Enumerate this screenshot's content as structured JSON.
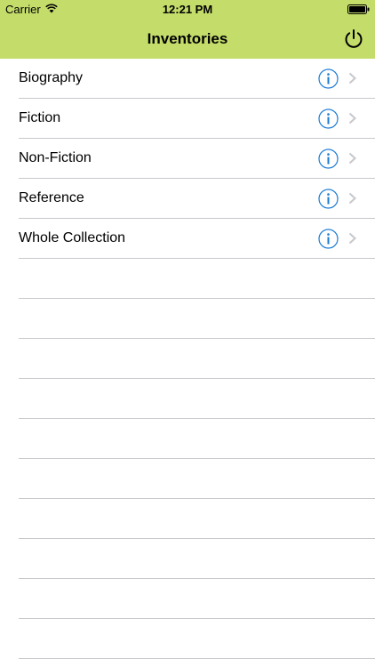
{
  "status_bar": {
    "carrier": "Carrier",
    "time": "12:21 PM",
    "wifi_icon": "wifi-icon",
    "battery_icon": "battery-icon"
  },
  "nav": {
    "title": "Inventories",
    "power_icon": "power-icon",
    "bar_color": "#c4dc6a"
  },
  "rows": [
    {
      "label": "Biography"
    },
    {
      "label": "Fiction"
    },
    {
      "label": "Non-Fiction"
    },
    {
      "label": "Reference"
    },
    {
      "label": "Whole Collection"
    }
  ],
  "accent_color": "#1a7bd6",
  "separator_color": "#c8c7cc"
}
